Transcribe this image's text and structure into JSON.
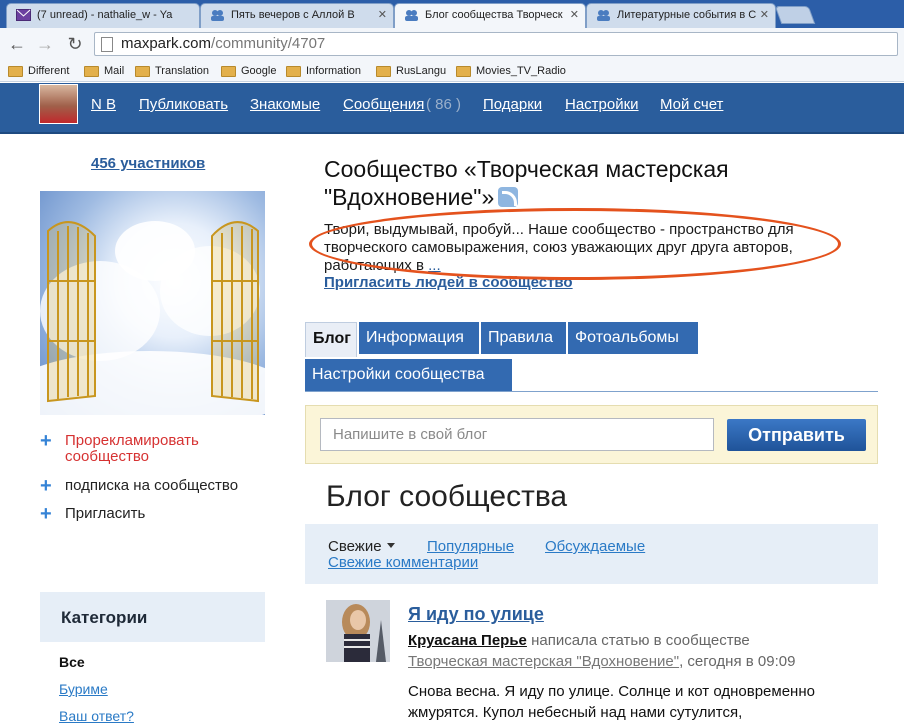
{
  "browser": {
    "tabs": [
      {
        "label": "(7 unread) - nathalie_w - Ya",
        "icon": "mail-icon"
      },
      {
        "label": "Пять вечеров с Аллой В",
        "icon": "community-icon"
      },
      {
        "label": "Блог сообщества Творческ",
        "icon": "community-icon"
      },
      {
        "label": "Литературные события в С",
        "icon": "community-icon"
      }
    ],
    "url_domain": "maxpark.com",
    "url_path": "/community/4707",
    "bookmarks": [
      "Different",
      "Mail",
      "Translation",
      "Google",
      "Information",
      "RusLangu",
      "Movies_TV_Radio"
    ]
  },
  "header": {
    "user": "N B",
    "nav": {
      "publish": "Публиковать",
      "acquaintances": "Знакомые",
      "messages": "Сообщения",
      "messages_count": "( 86 )",
      "gifts": "Подарки",
      "settings": "Настройки",
      "account": "Мой счет"
    }
  },
  "sidebar": {
    "members": "456 участников",
    "actions": {
      "promote": "Прорекламировать сообщество",
      "subscribe": "подписка на сообщество",
      "invite": "Пригласить"
    },
    "categories_title": "Категории",
    "categories": [
      "Все",
      "Буриме",
      "Ваш ответ?"
    ]
  },
  "community": {
    "title": "Сообщество «Творческая мастерская \"Вдохновение\"»",
    "description": "Твори, выдумывай, пробуй... Наше сообщество - пространство для творческого самовыражения, союз уважающих друг друга авторов, работающих в",
    "more": "...",
    "invite_people": "Пригласить людей в сообщество"
  },
  "tabs": {
    "blog": "Блог",
    "info": "Информация",
    "rules": "Правила",
    "albums": "Фотоальбомы",
    "settings": "Настройки сообщества"
  },
  "post_box": {
    "placeholder": "Напишите в свой блог",
    "send": "Отправить"
  },
  "blog": {
    "heading": "Блог сообщества",
    "filters": {
      "fresh": "Свежие",
      "popular": "Популярные",
      "discussed": "Обсуждаемые",
      "fresh_comments": "Свежие комментарии"
    },
    "post": {
      "title": "Я иду по улице",
      "author": "Круасана Перье",
      "action": "написала статью в сообществе",
      "community": "Творческая мастерская \"Вдохновение\"",
      "time": ", сегодня в 09:09",
      "body": "Снова весна. Я иду по улице. Солнце и кот одновременно жмурятся. Купол небесный над нами сутулится,"
    }
  }
}
